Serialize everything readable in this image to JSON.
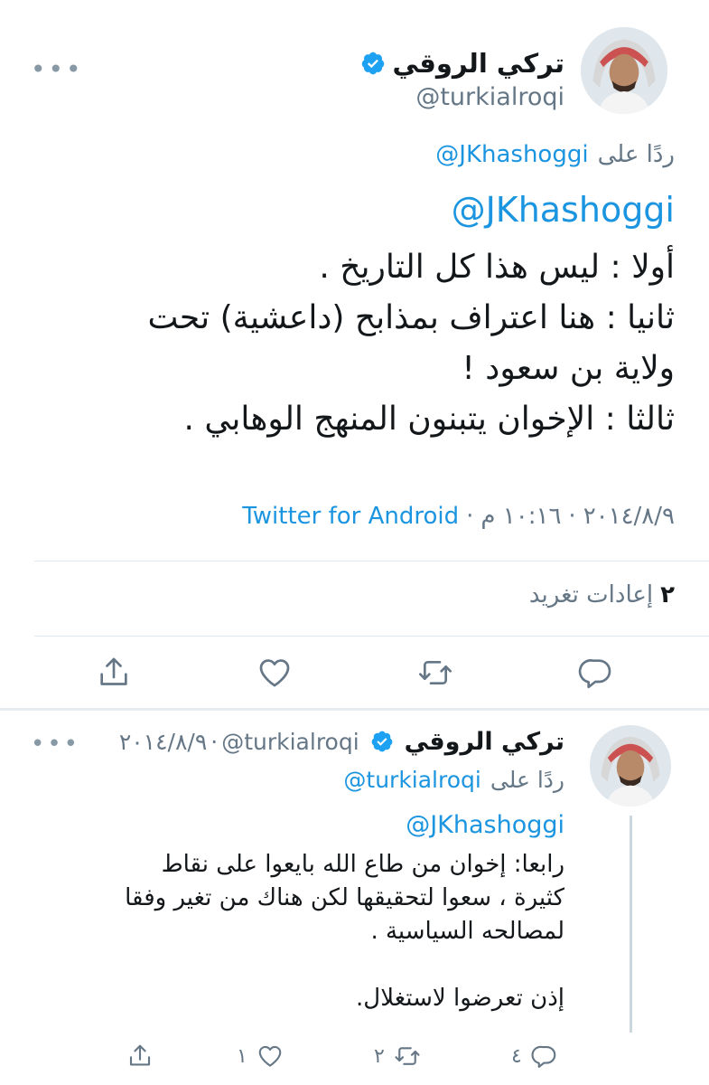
{
  "main_tweet": {
    "author_name": "تركي الروقي",
    "handle": "@turkialroqi",
    "more": "•••",
    "replying_to_label": "ردًا على",
    "replying_to_handle": "@JKhashoggi",
    "mention": "@JKhashoggi",
    "body_lines": [
      "أولا : ليس هذا كل التاريخ .",
      "ثانيا : هنا اعتراف بمذابح (داعشية) تحت",
      "ولاية بن سعود !",
      "ثالثا : الإخوان يتبنون المنهج الوهابي ."
    ],
    "date": "٢٠١٤/٨/٩",
    "separator": "·",
    "time": "١٠:١٦ م",
    "source": "Twitter for Android",
    "retweets_count": "٢",
    "retweets_label": "إعادات تغريد"
  },
  "reply_tweet": {
    "author_name": "تركي الروقي",
    "handle": "@turkialroqi",
    "separator": "·",
    "date": "٢٠١٤/٨/٩",
    "more": "•••",
    "replying_to_label": "ردًا على",
    "replying_to_handle": "@turkialroqi",
    "mention": "@JKhashoggi",
    "body_lines": [
      "رابعا: إخوان من طاع الله بايعوا على نقاط",
      "كثيرة ، سعوا لتحقيقها لكن هناك من تغير وفقا",
      "لمصالحه السياسية .",
      "",
      "إذن تعرضوا لاستغلال."
    ],
    "reply_count": "٤",
    "retweet_count": "٢",
    "like_count": "١"
  },
  "colors": {
    "link": "#1b95e0",
    "text": "#14171a",
    "secondary": "#657786",
    "divider": "#e1e8ed",
    "verified": "#1da1f2"
  },
  "icons": [
    "verified-badge-icon",
    "reply-icon",
    "retweet-icon",
    "like-icon",
    "share-icon",
    "more-icon"
  ]
}
